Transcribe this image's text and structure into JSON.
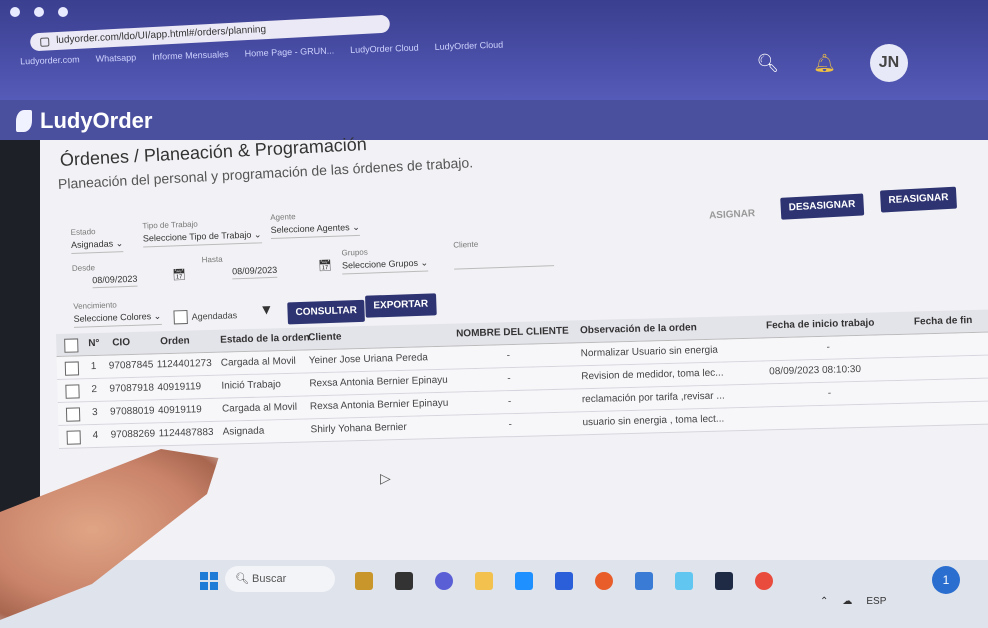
{
  "browser": {
    "tabs": [
      "•",
      "•",
      "•"
    ],
    "url": "ludyorder.com/ldo/UI/app.html#/orders/planning",
    "bookmarks": [
      "Ludyorder.com",
      "Whatsapp",
      "Informe Mensuales",
      "Home Page - GRUN...",
      "LudyOrder Cloud",
      "LudyOrder Cloud"
    ]
  },
  "app": {
    "brand": "LudyOrder",
    "avatar_initials": "JN"
  },
  "page": {
    "title": "Órdenes / Planeación & Programación",
    "subtitle": "Planeación del personal y programación de las órdenes de trabajo."
  },
  "filters": {
    "estado_label": "Estado",
    "estado_value": "Asignadas",
    "tipo_label": "Tipo de Trabajo",
    "tipo_value": "Seleccione Tipo de Trabajo",
    "agente_label": "Agente",
    "agente_value": "Seleccione Agentes",
    "desde_label": "Desde",
    "desde_value": "08/09/2023",
    "hasta_label": "Hasta",
    "hasta_value": "08/09/2023",
    "grupos_label": "Grupos",
    "grupos_value": "Seleccione Grupos",
    "cliente_label": "Cliente",
    "vencimiento_label": "Vencimiento",
    "vencimiento_value": "Seleccione Colores",
    "agendadas_label": "Agendadas"
  },
  "buttons": {
    "consultar": "CONSULTAR",
    "exportar": "EXPORTAR",
    "asignar": "ASIGNAR",
    "desasignar": "DESASIGNAR",
    "reasignar": "REASIGNAR"
  },
  "table": {
    "columns": [
      "N°",
      "CIO",
      "Orden",
      "Estado de la orden",
      "Cliente",
      "NOMBRE DEL CLIENTE",
      "Observación de la orden",
      "Fecha de inicio trabajo",
      "Fecha de fin"
    ],
    "rows": [
      {
        "n": "1",
        "cio": "97087845",
        "orden": "1124401273",
        "estado": "Cargada al Movil",
        "cliente": "Yeiner Jose Uriana Pereda",
        "nombre": "-",
        "observacion": "Normalizar Usuario sin energia",
        "inicio": "-"
      },
      {
        "n": "2",
        "cio": "97087918",
        "orden": "40919119",
        "estado": "Inició Trabajo",
        "cliente": "Rexsa Antonia Bernier Epinayu",
        "nombre": "-",
        "observacion": "Revision de medidor, toma lec...",
        "inicio": "08/09/2023 08:10:30"
      },
      {
        "n": "3",
        "cio": "97088019",
        "orden": "40919119",
        "estado": "Cargada al Movil",
        "cliente": "Rexsa Antonia Bernier Epinayu",
        "nombre": "-",
        "observacion": "reclamación por tarifa ,revisar ...",
        "inicio": "-"
      },
      {
        "n": "4",
        "cio": "97088269",
        "orden": "1124487883",
        "estado": "Asignada",
        "cliente": "Shirly Yohana Bernier",
        "nombre": "-",
        "observacion": "usuario sin energia , toma lect...",
        "inicio": ""
      }
    ]
  },
  "taskbar": {
    "search_placeholder": "Buscar",
    "lang": "ESP",
    "notification_count": "1"
  },
  "colors": {
    "header": "#4a4f9e",
    "button": "#2e3471"
  }
}
